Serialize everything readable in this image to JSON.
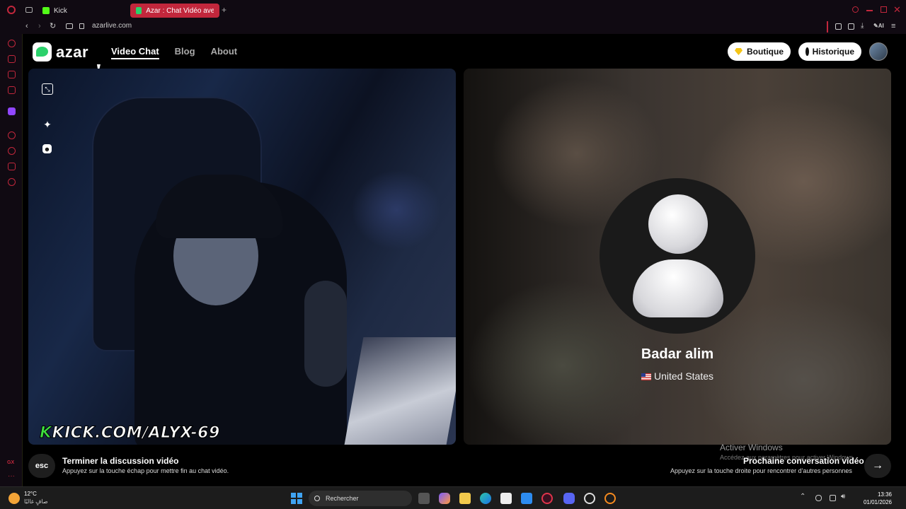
{
  "browser": {
    "tabs": [
      {
        "label": "Kick",
        "favicon_color": "#53fc18"
      },
      {
        "label": "Azar : Chat Vidéo avec de",
        "favicon_color": "#2bd16b"
      }
    ],
    "url": "azarlive.com",
    "accent": "#c2273c"
  },
  "header": {
    "logo_text": "azar",
    "nav": [
      {
        "label": "Video Chat",
        "active": true
      },
      {
        "label": "Blog",
        "active": false
      },
      {
        "label": "About",
        "active": false
      }
    ],
    "boutique_label": "Boutique",
    "historique_label": "Historique"
  },
  "left_video": {
    "watermark_k": "K",
    "watermark_text": "KICK.COM/ALYX-69",
    "controls": [
      "exit-fullscreen-icon",
      "sparkle-icon",
      "emoji-icon"
    ]
  },
  "right_video": {
    "name": "Badar alim",
    "country": "United States"
  },
  "bottom": {
    "esc_key": "esc",
    "end_title": "Terminer la discussion vidéo",
    "end_subtitle": "Appuyez sur la touche échap pour mettre fin au chat vidéo.",
    "next_title": "Prochaine conversation vidéo",
    "next_subtitle": "Appuyez sur la touche droite pour rencontrer d'autres personnes",
    "next_arrow": "→",
    "activate_title": "Activer Windows",
    "activate_subtitle": "Accédez aux paramètres pour activer Windows."
  },
  "taskbar": {
    "temperature": "12°C",
    "weather_desc": "صافٍ غالبًا",
    "search_placeholder": "Rechercher",
    "time": "13:36",
    "date": "01/01/2026"
  }
}
